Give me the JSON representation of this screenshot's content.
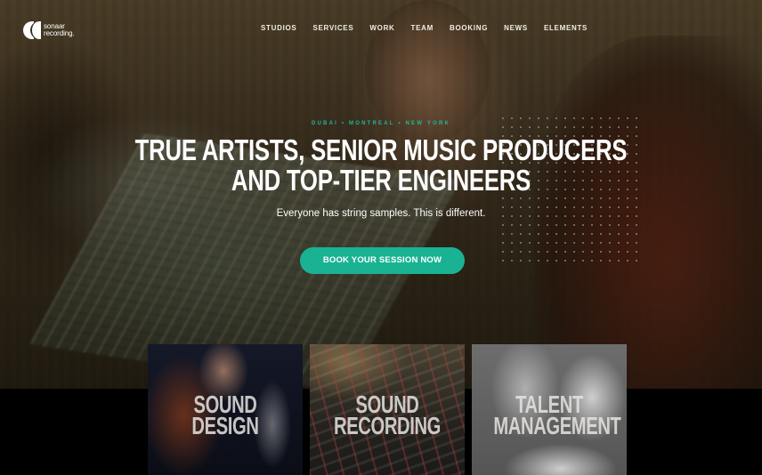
{
  "brand": {
    "name_line1": "sonaar",
    "name_line2": "recording.",
    "icon": "sonaar-logo-icon"
  },
  "nav": {
    "items": [
      {
        "label": "STUDIOS"
      },
      {
        "label": "SERVICES"
      },
      {
        "label": "WORK"
      },
      {
        "label": "TEAM"
      },
      {
        "label": "BOOKING"
      },
      {
        "label": "NEWS"
      },
      {
        "label": "ELEMENTS"
      }
    ]
  },
  "hero": {
    "locations": "DUBAI • MONTREAL • NEW YORK",
    "headline_line1": "TRUE ARTISTS, SENIOR MUSIC PRODUCERS",
    "headline_line2": "AND TOP-TIER ENGINEERS",
    "subline": "Everyone has string samples. This is different.",
    "cta_label": "BOOK YOUR SESSION NOW"
  },
  "services": [
    {
      "title_line1": "SOUND",
      "title_line2": "DESIGN"
    },
    {
      "title_line1": "SOUND",
      "title_line2": "RECORDING"
    },
    {
      "title_line1": "TALENT",
      "title_line2": "MANAGEMENT"
    }
  ],
  "colors": {
    "accent": "#19b393",
    "location_text": "#1db997",
    "text": "#ffffff"
  }
}
